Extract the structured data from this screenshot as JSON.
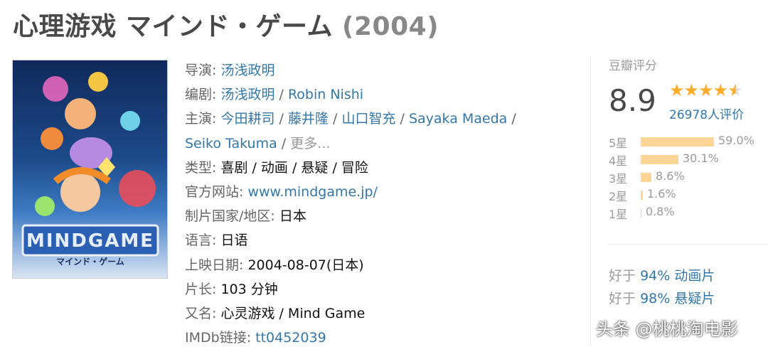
{
  "title": {
    "main": "心理游戏 マインド・ゲーム",
    "year": "(2004)"
  },
  "poster": {
    "logo": "MINDGAME",
    "sub": "マインド・ゲーム"
  },
  "info": {
    "director_label": "导演:",
    "director": "汤浅政明",
    "writer_label": "编剧:",
    "writers": [
      "汤浅政明",
      "Robin Nishi"
    ],
    "cast_label": "主演:",
    "cast": [
      "今田耕司",
      "藤井隆",
      "山口智充",
      "Sayaka Maeda",
      "Seiko Takuma"
    ],
    "more": "更多...",
    "genre_label": "类型:",
    "genre": "喜剧 / 动画 / 悬疑 / 冒险",
    "website_label": "官方网站:",
    "website": "www.mindgame.jp/",
    "country_label": "制片国家/地区:",
    "country": "日本",
    "language_label": "语言:",
    "language": "日语",
    "release_label": "上映日期:",
    "release": "2004-08-07(日本)",
    "runtime_label": "片长:",
    "runtime": "103 分钟",
    "aka_label": "又名:",
    "aka": "心灵游戏 / Mind Game",
    "imdb_label": "IMDb链接:",
    "imdb": "tt0452039"
  },
  "rating": {
    "title": "豆瓣评分",
    "score": "8.9",
    "stars": 4.5,
    "votes": "26978人评价",
    "distribution": [
      {
        "label": "5星",
        "pct": "59.0%",
        "value": 59.0
      },
      {
        "label": "4星",
        "pct": "30.1%",
        "value": 30.1
      },
      {
        "label": "3星",
        "pct": "8.6%",
        "value": 8.6
      },
      {
        "label": "2星",
        "pct": "1.6%",
        "value": 1.6
      },
      {
        "label": "1星",
        "pct": "0.8%",
        "value": 0.8
      }
    ],
    "better_than": [
      {
        "prefix": "好于",
        "pct": "94%",
        "category": "动画片"
      },
      {
        "prefix": "好于",
        "pct": "98%",
        "category": "悬疑片"
      }
    ]
  },
  "watermark": "头条 @桃桃淘电影",
  "colors": {
    "link": "#3377aa",
    "star": "#ffac2d",
    "bar": "#ffd596"
  }
}
